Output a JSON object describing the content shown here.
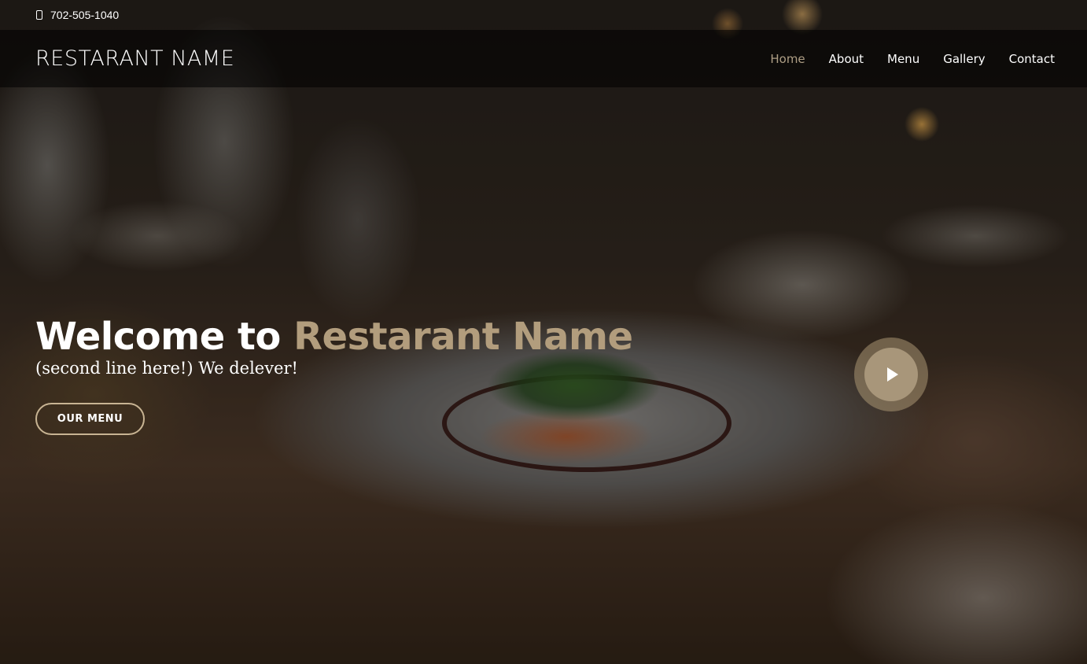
{
  "topbar": {
    "phone": "702-505-1040",
    "phone_icon": "phone-icon"
  },
  "header": {
    "brand": "RESTARANT NAME",
    "nav": [
      {
        "label": "Home",
        "active": true
      },
      {
        "label": "About",
        "active": false
      },
      {
        "label": "Menu",
        "active": false
      },
      {
        "label": "Gallery",
        "active": false
      },
      {
        "label": "Contact",
        "active": false
      }
    ]
  },
  "hero": {
    "title_prefix": "Welcome to ",
    "title_accent": "Restarant Name",
    "subtitle": "(second line here!) We delever!",
    "button_label": "OUR MENU",
    "play_icon": "play-icon"
  },
  "colors": {
    "accent": "#b29d7d",
    "nav_active": "#c9b79a",
    "button_border": "#c8b493"
  }
}
